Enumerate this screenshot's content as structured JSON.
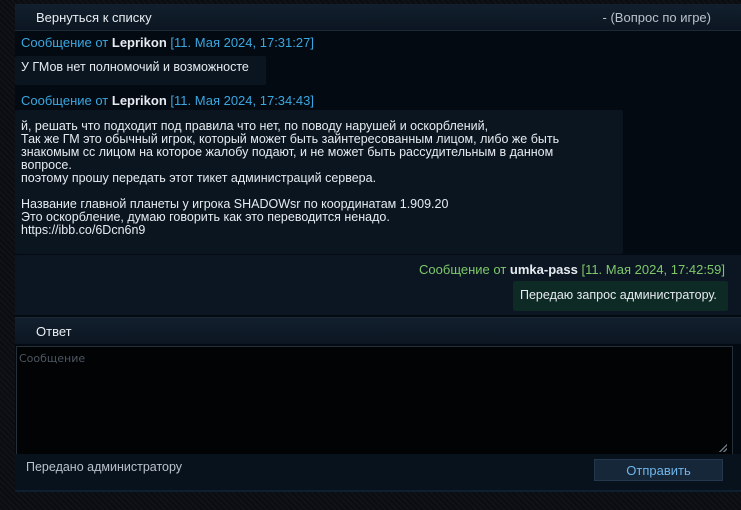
{
  "header": {
    "back_label": "Вернуться к списку",
    "topic": "- (Вопрос по игре)"
  },
  "messages": [
    {
      "prefix": "Сообщение от ",
      "author": "Leprikon",
      "date": "[11. Мая 2024, 17:31:27]",
      "lines": [
        "У ГМов нет полномочий и возможносте"
      ]
    },
    {
      "prefix": "Сообщение от ",
      "author": "Leprikon",
      "date": "[11. Мая 2024, 17:34:43]",
      "lines": [
        "й, решать что подходит под правила что нет, по поводу нарушей и оскорблений,",
        "Так же ГМ это обычный игрок, который может быть зайнтересованным лицом, либо же быть",
        "знакомым сс лицом на которое жалобу подают, и не может быть рассудительным в данном",
        "вопросе.",
        "поэтому прошу передать этот тикет администраций сервера.",
        "",
        "Название главной планеты у игрока SHADOWsr по координатам 1.909.20",
        "Это оскорбление, думаю говорить как это переводится ненадо.",
        "https://ibb.co/6Dcn6n9"
      ]
    },
    {
      "prefix": "Сообщение от ",
      "author": "umka-pass",
      "date": "[11. Мая 2024, 17:42:59]",
      "lines": [
        "Передаю запрос администратору."
      ]
    }
  ],
  "reply": {
    "title": "Ответ",
    "placeholder": "Сообщение",
    "status": "Передано администратору",
    "send_label": "Отправить"
  }
}
